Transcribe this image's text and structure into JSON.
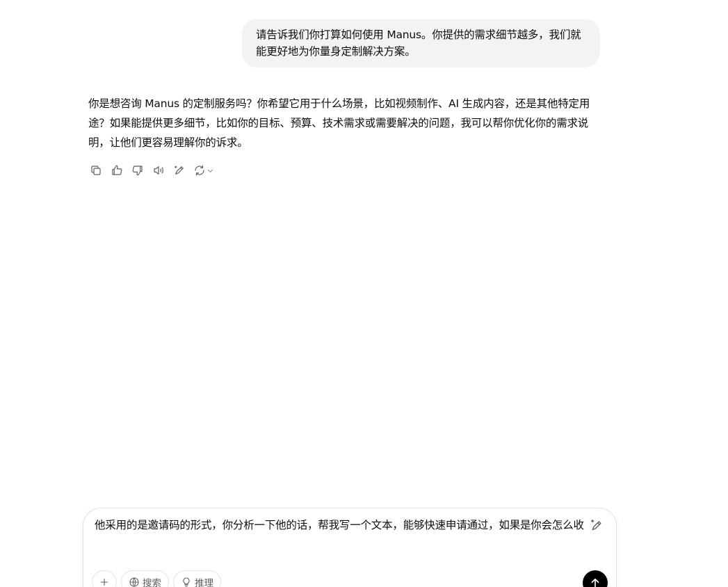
{
  "conversation": {
    "user_message": "请告诉我们你打算如何使用 Manus。你提供的需求细节越多，我们就能更好地为你量身定制解决方案。",
    "assistant_message": "你是想咨询 Manus 的定制服务吗？你希望它用于什么场景，比如视频制作、AI 生成内容，还是其他特定用途？如果能提供更多细节，比如你的目标、预算、技术需求或需要解决的问题，我可以帮你优化你的需求说明，让他们更容易理解你的诉求。",
    "actions": [
      "copy-icon",
      "thumbs-up-icon",
      "thumbs-down-icon",
      "read-aloud-icon",
      "edit-magic-icon",
      "regenerate-icon"
    ]
  },
  "composer": {
    "text": "他采用的是邀请码的形式，你分析一下他的话，帮我写一个文本，能够快速申请通过，如果是你会怎么收",
    "tools": {
      "search_label": "搜索",
      "reason_label": "推理"
    }
  }
}
